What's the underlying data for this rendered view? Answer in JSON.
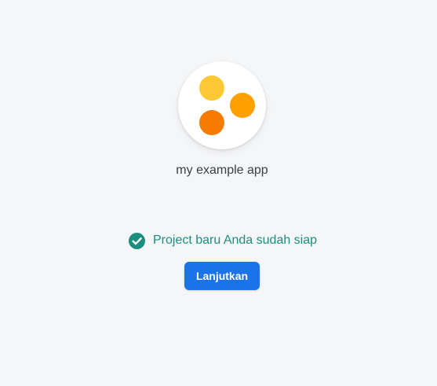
{
  "app": {
    "name": "my example app",
    "logo_colors": [
      "#fcc934",
      "#ffa000",
      "#f57c00"
    ]
  },
  "status": {
    "text": "Project baru Anda sudah siap",
    "icon": "check-circle-icon",
    "color": "#1a8e7f"
  },
  "actions": {
    "continue_label": "Lanjutkan",
    "accent": "#1a73e8"
  }
}
